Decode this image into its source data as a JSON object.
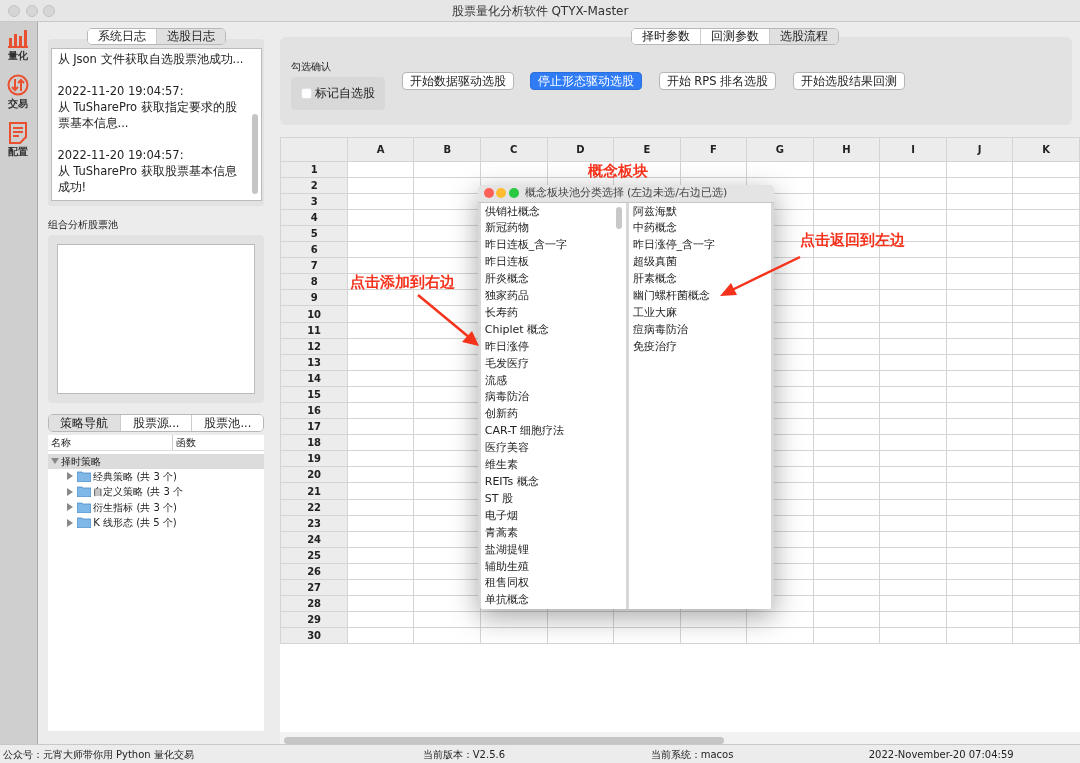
{
  "window": {
    "title": "股票量化分析软件 QTYX-Master"
  },
  "sidebar": {
    "items": [
      {
        "label": "量化",
        "kind": "chart"
      },
      {
        "label": "交易",
        "kind": "trade"
      },
      {
        "label": "配置",
        "kind": "doc"
      }
    ]
  },
  "log_panel": {
    "tabs": [
      {
        "label": "系统日志",
        "selected": false
      },
      {
        "label": "选股日志",
        "selected": true
      }
    ],
    "entries": [
      {
        "lines": [
          "从 Json 文件获取自选股票池成功..."
        ]
      },
      {
        "lines": [
          "2022-11-20 19:04:57:",
          "从 TuSharePro 获取指定要求的股票基本信息..."
        ]
      },
      {
        "lines": [
          "2022-11-20 19:04:57:",
          "从 TuSharePro 获取股票基本信息成功!"
        ]
      }
    ]
  },
  "pool_panel": {
    "title": "组合分析股票池"
  },
  "nav_panel": {
    "tabs": [
      {
        "label": "策略导航",
        "selected": true
      },
      {
        "label": "股票源...",
        "selected": false
      },
      {
        "label": "股票池...",
        "selected": false
      }
    ],
    "columns": [
      "名称",
      "函数"
    ],
    "tree": [
      {
        "label": "择时策略",
        "expanded": true,
        "children": [
          {
            "label": "经典策略 (共 3 个)",
            "expanded": false
          },
          {
            "label": "自定义策略 (共 3 个",
            "expanded": false
          },
          {
            "label": "衍生指标 (共 3 个)",
            "expanded": false
          },
          {
            "label": "K 线形态 (共 5 个)",
            "expanded": false
          }
        ]
      }
    ]
  },
  "top_tabs": [
    {
      "label": "择时参数",
      "selected": false
    },
    {
      "label": "回测参数",
      "selected": false
    },
    {
      "label": "选股流程",
      "selected": true
    }
  ],
  "confirm_group": {
    "title": "勾选确认",
    "checkbox": {
      "label": "标记自选股",
      "checked": false
    }
  },
  "buttons": [
    {
      "label": "开始数据驱动选股",
      "primary": false
    },
    {
      "label": "停止形态驱动选股",
      "primary": true
    },
    {
      "label": "开始 RPS 排名选股",
      "primary": false
    },
    {
      "label": "开始选股结果回测",
      "primary": false
    }
  ],
  "sheet": {
    "columns": [
      "A",
      "B",
      "C",
      "D",
      "E",
      "F",
      "G",
      "H",
      "I",
      "J",
      "K"
    ],
    "rows": [
      "1",
      "2",
      "3",
      "4",
      "5",
      "6",
      "7",
      "8",
      "9",
      "10",
      "11",
      "12",
      "13",
      "14",
      "15",
      "16",
      "17",
      "18",
      "19",
      "20",
      "21",
      "22",
      "23",
      "24",
      "25",
      "26",
      "27",
      "28",
      "29",
      "30"
    ]
  },
  "dialog": {
    "title": "概念板块池分类选择 (左边未选/右边已选)",
    "left_items": [
      "供销社概念",
      "新冠药物",
      "昨日连板_含一字",
      "昨日连板",
      "肝炎概念",
      "独家药品",
      "长寿药",
      "Chiplet 概念",
      "昨日涨停",
      "毛发医疗",
      "流感",
      "病毒防治",
      "创新药",
      "CAR-T 细胞疗法",
      "医疗美容",
      "维生素",
      "REITs 概念",
      "ST 股",
      "电子烟",
      "青蒿素",
      "盐湖提锂",
      "辅助生殖",
      "租售同权",
      "单抗概念"
    ],
    "right_items": [
      "阿兹海默",
      "中药概念",
      "昨日涨停_含一字",
      "超级真菌",
      "肝素概念",
      "幽门螺杆菌概念",
      "工业大麻",
      "痘病毒防治",
      "免疫治疗"
    ]
  },
  "annotations": [
    {
      "text": "概念板块"
    },
    {
      "text": "点击添加到右边"
    },
    {
      "text": "点击返回到左边"
    }
  ],
  "status_bar": {
    "account": "公众号：元宵大师带你用 Python 量化交易",
    "version": "当前版本：V2.5.6",
    "system": "当前系统：macos",
    "time": "2022-November-20 07:04:59"
  }
}
